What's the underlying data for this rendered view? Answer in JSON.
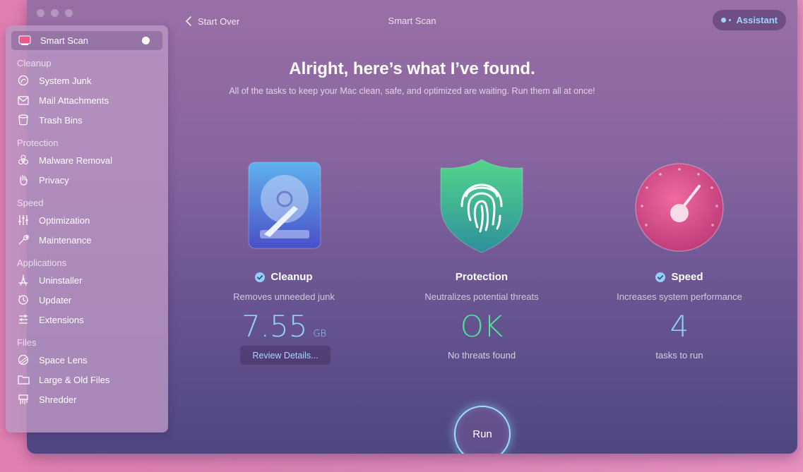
{
  "window": {
    "title": "Smart Scan",
    "back_label": "Start Over",
    "assistant_label": "Assistant"
  },
  "sidebar": {
    "selected": {
      "label": "Smart Scan",
      "icon": "smart-scan-icon"
    },
    "sections": [
      {
        "heading": "Cleanup",
        "items": [
          {
            "label": "System Junk",
            "icon": "system-junk-icon"
          },
          {
            "label": "Mail Attachments",
            "icon": "mail-icon"
          },
          {
            "label": "Trash Bins",
            "icon": "trash-icon"
          }
        ]
      },
      {
        "heading": "Protection",
        "items": [
          {
            "label": "Malware Removal",
            "icon": "biohazard-icon"
          },
          {
            "label": "Privacy",
            "icon": "hand-icon"
          }
        ]
      },
      {
        "heading": "Speed",
        "items": [
          {
            "label": "Optimization",
            "icon": "sliders-icon"
          },
          {
            "label": "Maintenance",
            "icon": "wrench-icon"
          }
        ]
      },
      {
        "heading": "Applications",
        "items": [
          {
            "label": "Uninstaller",
            "icon": "uninstaller-icon"
          },
          {
            "label": "Updater",
            "icon": "updater-icon"
          },
          {
            "label": "Extensions",
            "icon": "extensions-icon"
          }
        ]
      },
      {
        "heading": "Files",
        "items": [
          {
            "label": "Space Lens",
            "icon": "space-lens-icon"
          },
          {
            "label": "Large & Old Files",
            "icon": "folder-icon"
          },
          {
            "label": "Shredder",
            "icon": "shredder-icon"
          }
        ]
      }
    ]
  },
  "main": {
    "headline": "Alright, here’s what I’ve found.",
    "subline": "All of the tasks to keep your Mac clean, safe, and optimized are waiting. Run them all at once!",
    "cleanup": {
      "label": "Cleanup",
      "desc": "Removes unneeded junk",
      "value": "7.55",
      "unit": "GB",
      "review_label": "Review Details..."
    },
    "protection": {
      "label": "Protection",
      "desc": "Neutralizes potential threats",
      "value": "OK",
      "sub": "No threats found"
    },
    "speed": {
      "label": "Speed",
      "desc": "Increases system performance",
      "value": "4",
      "sub": "tasks to run"
    },
    "run_label": "Run"
  },
  "colors": {
    "accent_blue": "#8fd0ff",
    "ok_green": "#4fe39a",
    "speed_pink": "#e0528a"
  }
}
